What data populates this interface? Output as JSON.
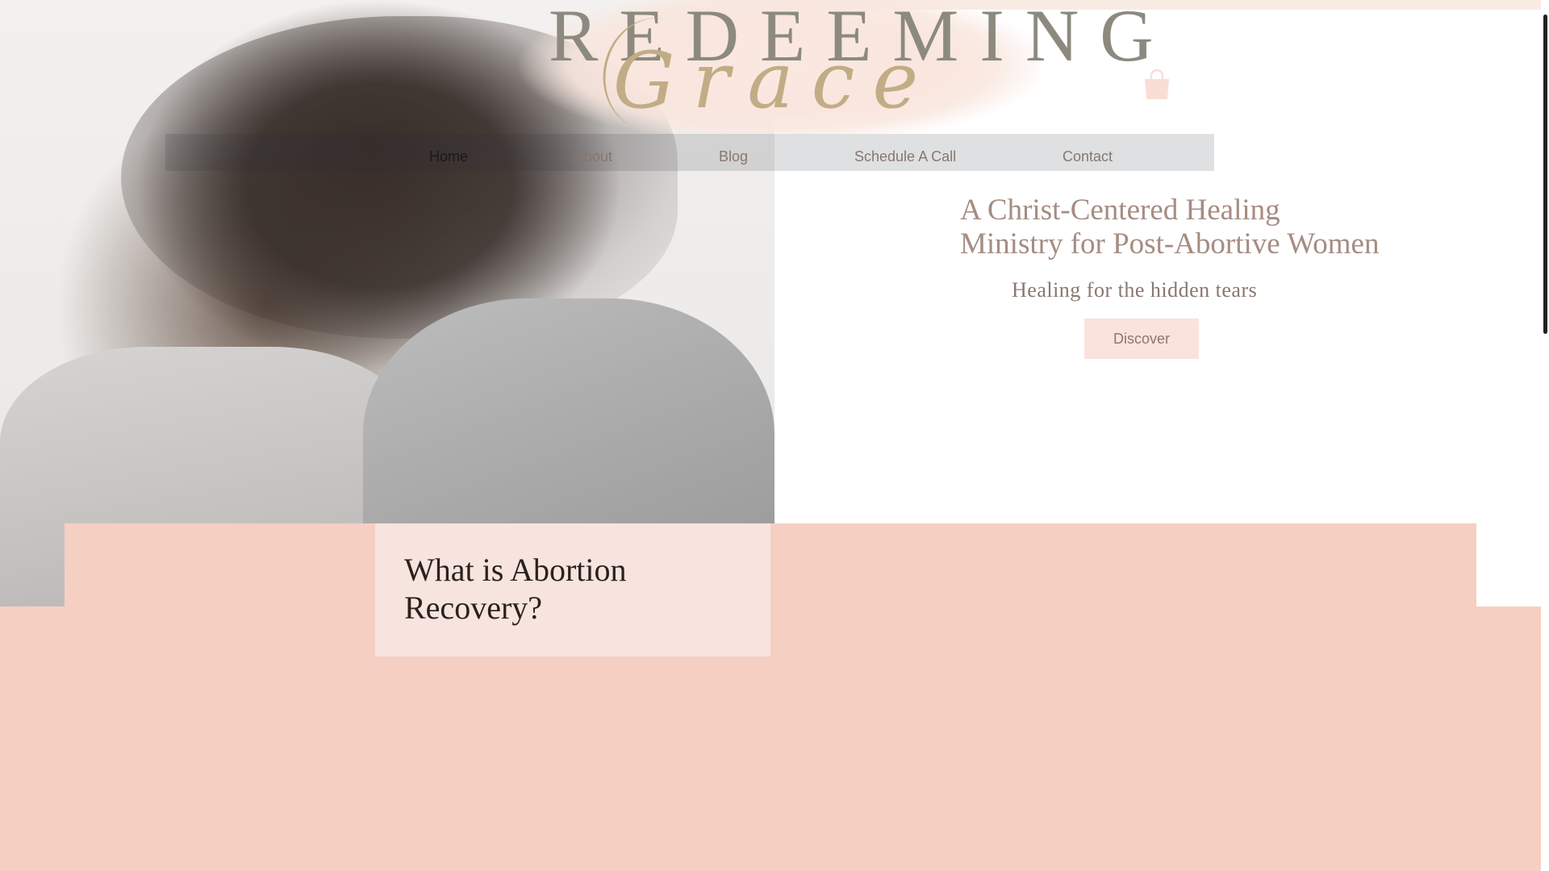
{
  "logo": {
    "line1": "REDEEMING",
    "line2": "Grace"
  },
  "cart": {
    "icon": "shopping-bag-icon",
    "color": "#f9ded5"
  },
  "nav": {
    "items": [
      {
        "label": "Home",
        "active": true
      },
      {
        "label": "About"
      },
      {
        "label": "Blog"
      },
      {
        "label": "Schedule A Call"
      },
      {
        "label": "Contact"
      }
    ]
  },
  "hero": {
    "title_line1": "A Christ-Centered Healing",
    "title_line2": "Ministry for Post-Abortive Women",
    "subtitle": "Healing for the hidden tears",
    "cta_label": "Discover"
  },
  "section": {
    "card_title": "What is Abortion Recovery?"
  },
  "colors": {
    "accent_pink": "#f6cfc3",
    "card_pink": "#f7e4de",
    "text_muted": "#a58c82",
    "logo_gold": "#c2ac86"
  }
}
